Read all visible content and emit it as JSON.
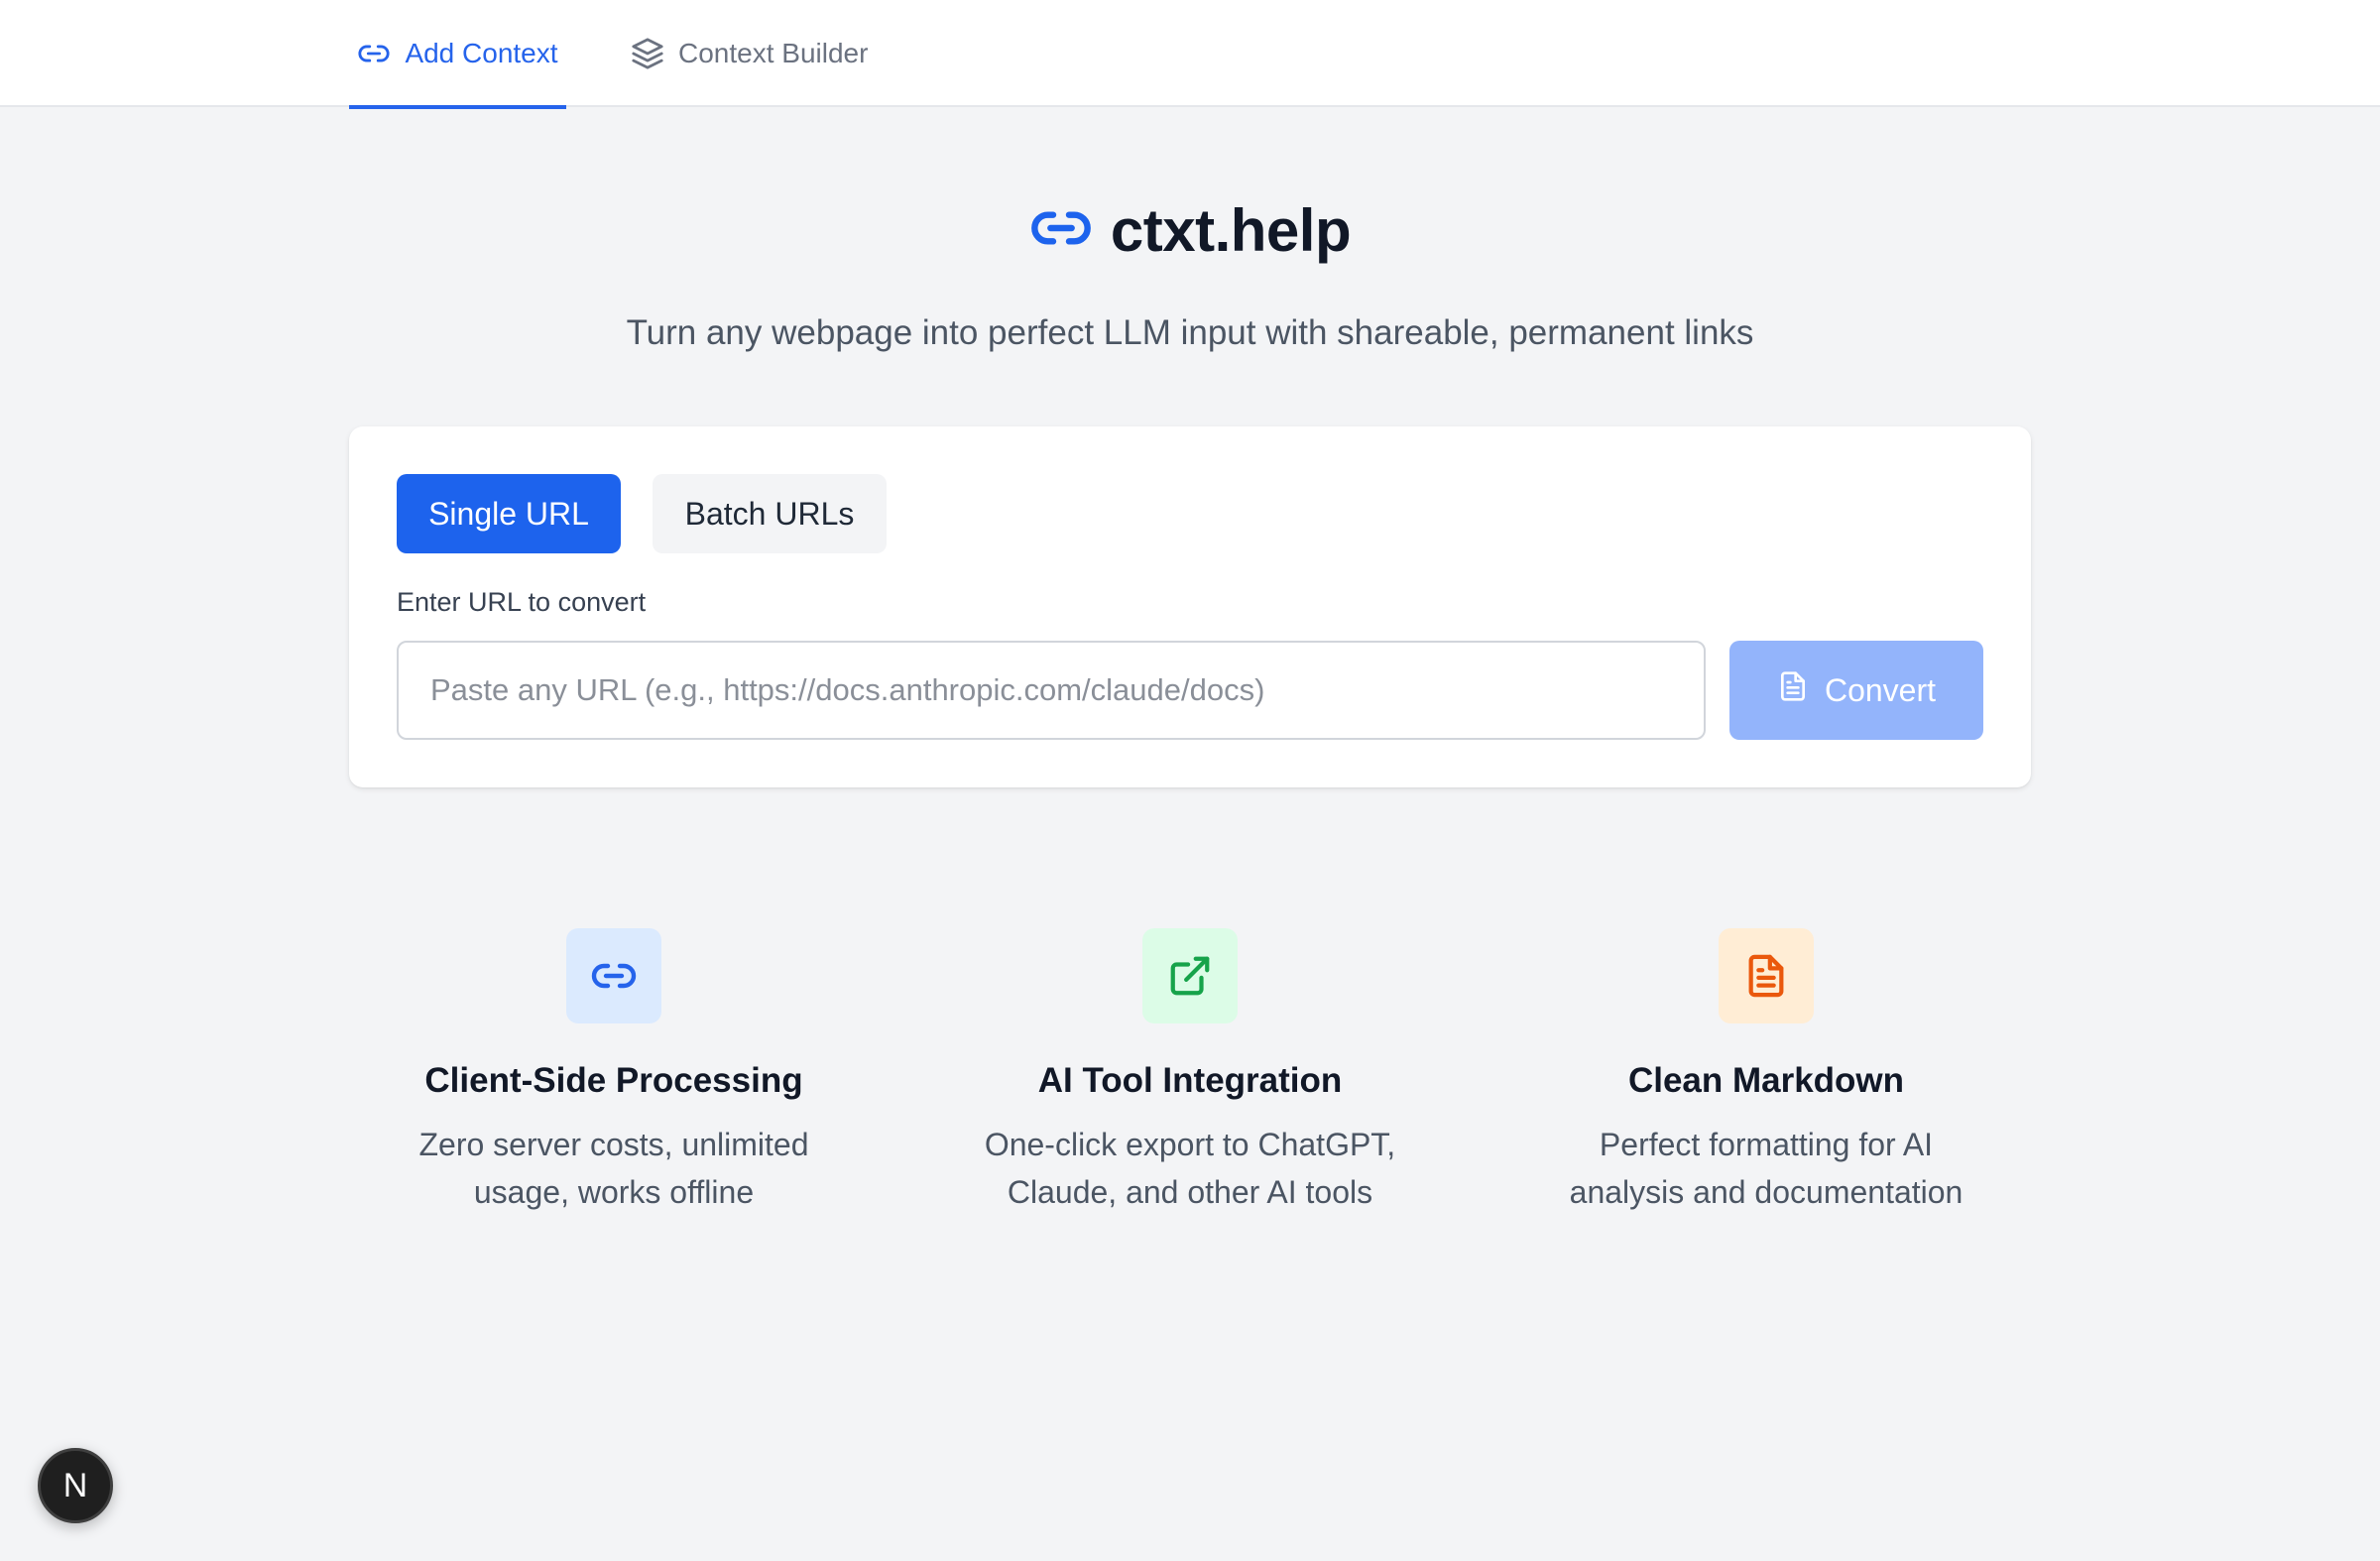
{
  "nav": {
    "tabs": [
      {
        "label": "Add Context",
        "icon": "link-icon",
        "active": true
      },
      {
        "label": "Context Builder",
        "icon": "layers-icon",
        "active": false
      }
    ]
  },
  "hero": {
    "title": "ctxt.help",
    "subtitle": "Turn any webpage into perfect LLM input with shareable, permanent links"
  },
  "card": {
    "modes": [
      "Single URL",
      "Batch URLs"
    ],
    "input_label": "Enter URL to convert",
    "input_placeholder": "Paste any URL (e.g., https://docs.anthropic.com/claude/docs)",
    "input_value": "",
    "convert_label": "Convert"
  },
  "features": [
    {
      "title": "Client-Side Processing",
      "desc": "Zero server costs, unlimited usage, works offline",
      "icon": "link-icon",
      "color": "#2563eb",
      "bg": "#dbeafe"
    },
    {
      "title": "AI Tool Integration",
      "desc": "One-click export to ChatGPT, Claude, and other AI tools",
      "icon": "external-link-icon",
      "color": "#16a34a",
      "bg": "#dcfce7"
    },
    {
      "title": "Clean Markdown",
      "desc": "Perfect formatting for AI analysis and documentation",
      "icon": "document-icon",
      "color": "#ea580c",
      "bg": "#ffedd5"
    }
  ],
  "badge": {
    "letter": "N"
  },
  "colors": {
    "accent": "#1d63ed",
    "convert_disabled": "#93b4fb",
    "background": "#f3f4f6"
  }
}
